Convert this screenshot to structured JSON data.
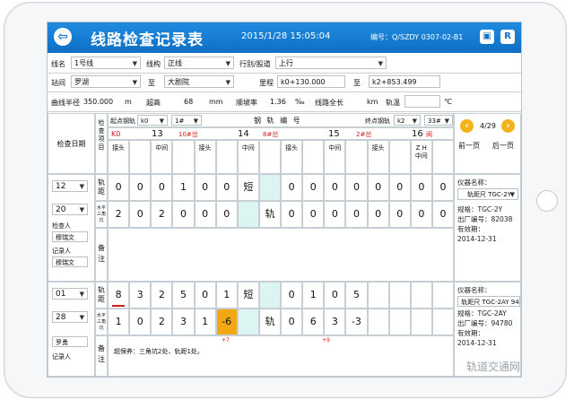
{
  "header": {
    "back": "⇦",
    "title": "线路检查记录表",
    "datetime": "2015/1/28 15:05:04",
    "doc_no": "编号：Q/SZDY 0307-02-B1",
    "icon1": "▣",
    "icon2": "R"
  },
  "form": {
    "line_label": "线名",
    "line_value": "1号线",
    "track_label": "线构",
    "track_value": "正线",
    "dir_label": "行别/股道",
    "dir_value": "上行",
    "station_label": "站间",
    "station_from": "罗湖",
    "to_label": "至",
    "station_to": "大剧院",
    "mileage_label": "里程",
    "mileage_from": "k0+130.000",
    "mileage_to_label": "至",
    "mileage_to": "k2+853.499",
    "curve_label": "曲线半径",
    "curve_value": "350.000",
    "curve_unit": "m",
    "super_label": "超高",
    "super_value": "68",
    "super_unit": "mm",
    "slope_label": "顺坡率",
    "slope_value": "1.36",
    "slope_unit": "‰",
    "length_label": "线路全长",
    "length_unit": "km",
    "temp_label": "轨温",
    "temp_unit": "℃"
  },
  "grid": {
    "date_header": "检查日期",
    "item_header": "检查项目",
    "start_label": "起点钢轨",
    "start_k": "k0",
    "start_no": "1#",
    "rail_no_label": "钢 轨 编 号",
    "end_label": "终点钢轨",
    "end_k": "k2",
    "end_no": "33#",
    "markers": [
      "K0",
      "13",
      "10#岔",
      "14",
      "8#岔",
      "15",
      "2#岔",
      "16"
    ],
    "marker_suffix": "阀",
    "sub_headers": [
      "接头",
      "中间",
      "接头",
      "中间",
      "接头",
      "中间",
      "接头",
      "Z H 中间"
    ],
    "nav_page": "4/29",
    "nav_prev": "前一页",
    "nav_next": "后一页",
    "block1": {
      "month": "12",
      "day": "20",
      "inspector_label": "检查人",
      "inspector": "穆瑞文",
      "recorder_label": "记录人",
      "recorder": "穆瑞文",
      "gauge_label": "轨距",
      "level_label": "水平三角坑",
      "remark_label": "备注",
      "gauge": [
        "0",
        "0",
        "0",
        "1",
        "0",
        "0",
        "短",
        "",
        "0",
        "0",
        "0",
        "0",
        "0",
        "0",
        "0",
        "0"
      ],
      "level": [
        "2",
        "0",
        "2",
        "0",
        "0",
        "0",
        "",
        "轨",
        "0",
        "0",
        "0",
        "0",
        "0",
        "0",
        "0",
        "0"
      ],
      "instrument_label": "仪器名称：",
      "instrument": "轨距尺 TGC-2Y",
      "spec": "规格：TGC-2Y",
      "serial": "出厂编号：82038",
      "valid": "有效期：",
      "valid_date": "2014-12-31"
    },
    "block2": {
      "month": "01",
      "day": "28",
      "inspector": "罗勇",
      "recorder_label": "记录人",
      "gauge_label": "轨距",
      "level_label": "水平三角坑",
      "remark_label": "备注",
      "gauge": [
        "8",
        "3",
        "2",
        "5",
        "0",
        "1",
        "短",
        "",
        "0",
        "1",
        "0",
        "5"
      ],
      "level": [
        "1",
        "0",
        "2",
        "3",
        "1",
        "-6",
        "",
        "轨",
        "0",
        "6",
        "3",
        "-3"
      ],
      "anno1": "+7",
      "anno2": "+9",
      "remark": "超保养：三角坑2处、轨距1处。",
      "instrument_label": "仪器名称：",
      "instrument": "轨距尺 TGC-2AY 94",
      "spec": "规格：TGC-2AY",
      "serial": "出厂编号：94780",
      "valid": "有效期：",
      "valid_date": "2014-12-31"
    }
  },
  "watermark": "轨道交通网"
}
